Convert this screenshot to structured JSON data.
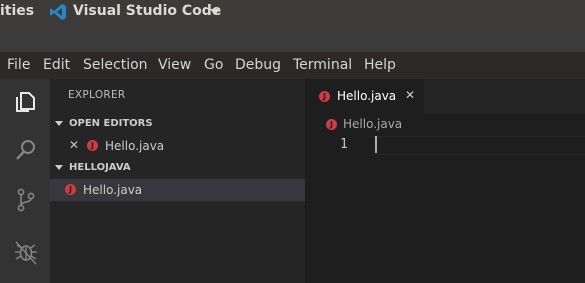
{
  "ubuntu_bar": {
    "activities_label": "ities",
    "app_name": "Visual Studio Code"
  },
  "menubar": {
    "items": [
      "File",
      "Edit",
      "Selection",
      "View",
      "Go",
      "Debug",
      "Terminal",
      "Help"
    ]
  },
  "activity_bar": {
    "icons": [
      "explorer-icon",
      "search-icon",
      "source-control-icon",
      "debug-icon"
    ]
  },
  "sidebar": {
    "title": "EXPLORER",
    "open_editors": {
      "header": "OPEN EDITORS",
      "files": [
        {
          "name": "Hello.java",
          "close": "✕"
        }
      ]
    },
    "folder": {
      "header": "HELLOJAVA",
      "files": [
        {
          "name": "Hello.java"
        }
      ]
    }
  },
  "editor": {
    "tab": {
      "label": "Hello.java",
      "close": "✕"
    },
    "breadcrumb": "Hello.java",
    "line_numbers": [
      "1"
    ]
  },
  "colors": {
    "java_icon": "#cc3e44",
    "vscode_blue": "#2489ca"
  }
}
